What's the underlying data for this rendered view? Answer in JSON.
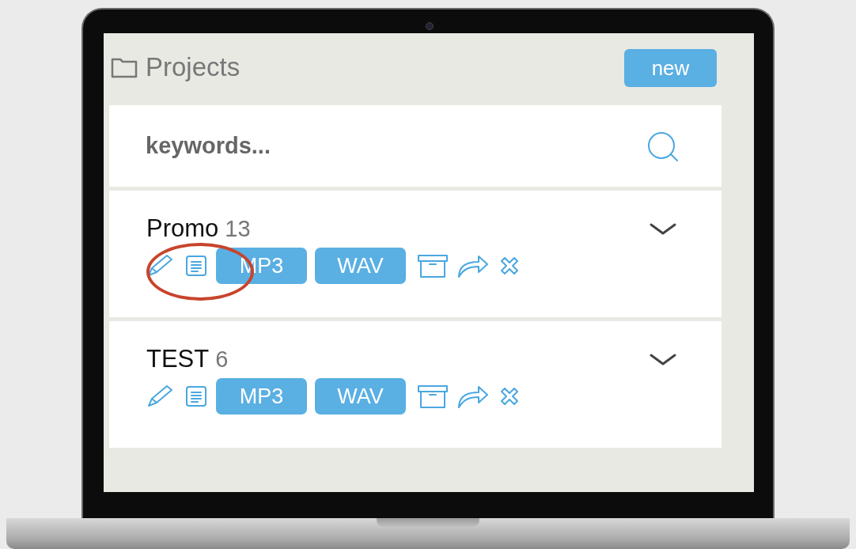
{
  "header": {
    "title": "Projects",
    "new_button": "new"
  },
  "search": {
    "placeholder": "keywords..."
  },
  "projects": [
    {
      "name": "Promo",
      "count": "13",
      "formats": [
        "MP3",
        "WAV"
      ]
    },
    {
      "name": "TEST",
      "count": "6",
      "formats": [
        "MP3",
        "WAV"
      ]
    }
  ]
}
